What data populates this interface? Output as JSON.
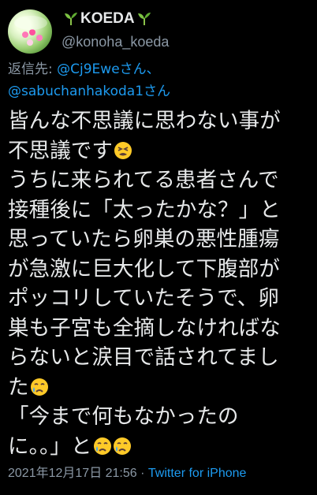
{
  "user": {
    "display_name": "KOEDA",
    "handle": "@konoha_koeda"
  },
  "reply": {
    "prefix": "返信先: ",
    "mention_1": "@Cj9Eweさん、",
    "mention_2": "@sabuchanhakoda1さん"
  },
  "tweet": {
    "lines": [
      "皆んな不思議に思わない事が",
      "不思議です",
      "うちに来られてる患者さんで",
      "接種後に「太ったかな？」と",
      "思っていたら卵巣の悪性腫瘍",
      "が急激に巨大化して下腹部が",
      "ポッコリしていたそうで、卵",
      "巣も子宮も全摘しなければな",
      "らないと涙目で話されてまし",
      "た",
      "「今まで何もなかったの",
      "に。。」と"
    ]
  },
  "meta": {
    "timestamp": "2021年12月17日 21:56",
    "separator": " · ",
    "source": "Twitter for iPhone"
  },
  "icons": {
    "sprout": "sprout-icon",
    "tired_face": "tired-face-icon",
    "crying_face": "crying-face-icon"
  },
  "colors": {
    "background": "#000000",
    "text": "#e7e9ea",
    "secondary": "#8b98a5",
    "link": "#1d9bf0"
  }
}
